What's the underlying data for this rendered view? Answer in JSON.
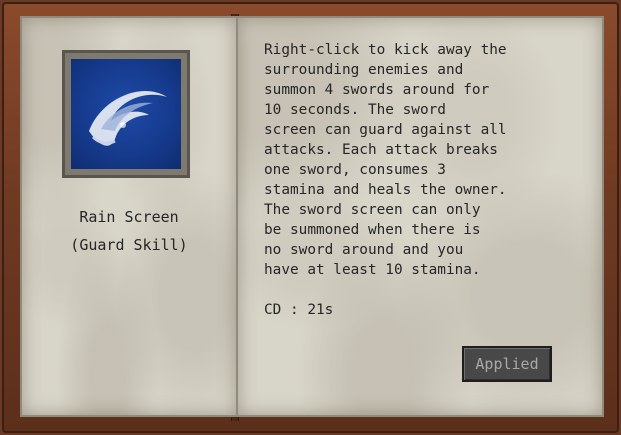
{
  "skill": {
    "name": "Rain Screen",
    "type": "(Guard Skill)",
    "icon": "swirl-wave-icon",
    "description": "Right-click to kick away the\nsurrounding enemies and\nsummon 4 swords around for\n10 seconds. The sword\nscreen can guard against all\nattacks. Each attack breaks\none sword, consumes 3\nstamina and heals the owner.\nThe sword screen can only\nbe summoned when there is\nno sword around and you\nhave at least 10 stamina.",
    "cooldown": "CD : 21s"
  },
  "button": {
    "label": "Applied"
  },
  "colors": {
    "cover": "#6f3a22",
    "page": "#d8d5c9",
    "text": "#262626",
    "icon_bg": "#163b8e",
    "button_bg": "#484848",
    "button_text": "#a9a9a9"
  }
}
